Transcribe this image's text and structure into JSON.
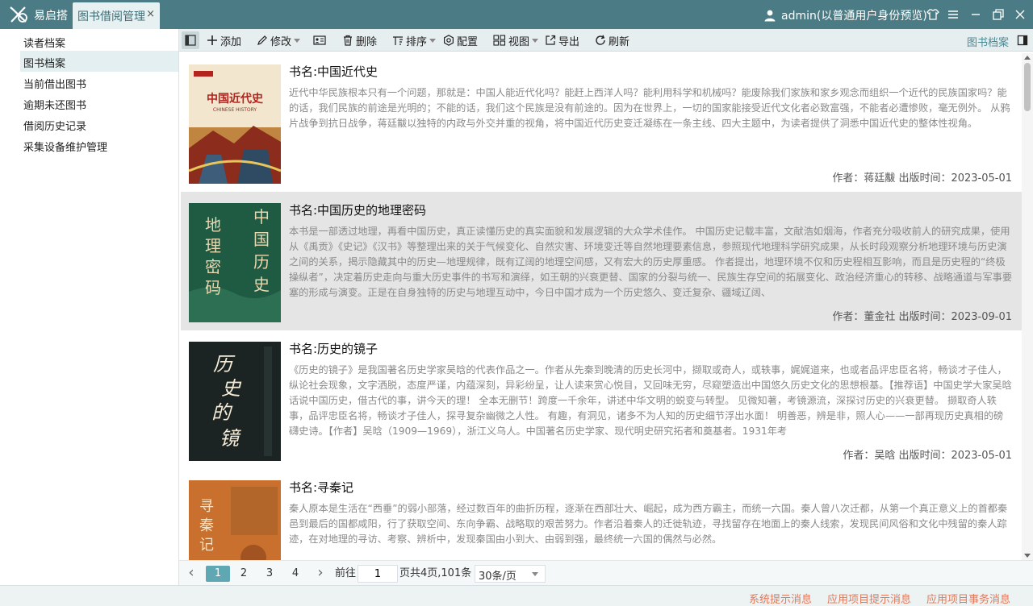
{
  "app": {
    "brand": "易启搭",
    "active_tab": "图书借阅管理",
    "close_glyph": "×",
    "user_label": "admin(以普通用户身份预览)"
  },
  "sidebar": {
    "items": [
      {
        "label": "读者档案"
      },
      {
        "label": "图书档案"
      },
      {
        "label": "当前借出图书"
      },
      {
        "label": "逾期未还图书"
      },
      {
        "label": "借阅历史记录"
      },
      {
        "label": "采集设备维护管理"
      }
    ],
    "active_index": 1
  },
  "toolbar": {
    "add": "添加",
    "edit": "修改",
    "delete": "删除",
    "sort": "排序",
    "config": "配置",
    "view": "视图",
    "export": "导出",
    "refresh": "刷新",
    "right_label": "图书档案"
  },
  "books": [
    {
      "title": "书名:中国近代史",
      "description": "近代中华民族根本只有一个问题，那就是：中国人能近代化吗？能赶上西洋人吗？能利用科学和机械吗？能废除我们家族和家乡观念而组织一个近代的民族国家吗？能的话，我们民族的前途是光明的；不能的话，我们这个民族是没有前途的。因为在世界上，一切的国家能接受近代文化者必致富强，不能者必遭惨败，毫无例外。 从鸦片战争到抗日战争，蒋廷黻以独特的内政与外交并重的视角，将中国近代历史变迁凝练在一条主线、四大主题中，为读者提供了洞悉中国近代史的整体性视角。",
      "meta": "作者：蒋廷黻   出版时间：2023-05-01",
      "cover": {
        "title": "中国近代史",
        "sub": "CHINESE HISTORY",
        "bg": "#f2e6cf",
        "accent": "#b3241e"
      }
    },
    {
      "title": "书名:中国历史的地理密码",
      "description": "本书是一部透过地理，再看中国历史，真正读懂历史的真实面貌和发展逻辑的大众学术佳作。 中国历史记载丰富，文献浩如烟海，作者充分吸收前人的研究成果，使用从《禹贡》《史记》《汉书》等整理出来的关于气候变化、自然灾害、环境变迁等自然地理要素信息，参照现代地理科学研究成果，从长时段观察分析地理环境与历史演之间的关系，揭示隐藏其中的历史—地理规律，既有辽阔的地理空间感，又有宏大的历史厚重感。 作者提出，地理环境不仅和历史程相互影响，而且是历史程的“终极操纵者”，决定着历史走向与重大历史事件的书写和演绎，如王朝的兴衰更替、国家的分裂与统一、民族生存空间的拓展变化、政治经济重心的转移、战略通道与军事要塞的形成与演变。正是在自身独特的历史与地理互动中，今日中国才成为一个历史悠久、变迁复杂、疆域辽阔、",
      "meta": "作者：董金社   出版时间：2023-09-01",
      "cover": {
        "title": "地理密码",
        "sub": "中国历史",
        "bg": "#1f5a43",
        "accent": "#e8d8b0"
      }
    },
    {
      "title": "书名:历史的镜子",
      "description": "《历史的镜子》是我国著名历史学家吴晗的代表作品之一。作者从先秦到晚清的历史长河中，撷取或奇人，或轶事，娓娓道来，也或者品评忠臣名将，畅谈才子佳人，纵论社会现象，文字洒脱，态度严谨，内蕴深刻，异彩纷呈，让人读来赏心悦目，又回味无穷，尽窥塑造出中国悠久历史文化的思想根基。【推荐语】中国史学大家吴晗话说中国历史，借古代的事，讲今天的理！ 全本无删节！跨度一千余年，讲述中华文明的蜕变与转型。 见微知著，考镜源流，深探讨历史的兴衰更替。 撷取奇人轶事，品评忠臣名将，畅谈才子佳人，探寻复杂幽微之人性。 有趣，有洞见，诸多不为人知的历史细节浮出水面！ 明善恶，辨是非，照人心——一部再现历史真相的磅礴史诗。【作者】吴晗（1909—1969），浙江义乌人。中国著名历史学家、现代明史研究拓者和奠基者。1931年考",
      "meta": "作者：吴晗   出版时间：2023-05-01",
      "cover": {
        "title": "历史的镜子",
        "sub": "吴晗",
        "bg": "#1b2422",
        "accent": "#f4ecd8"
      }
    },
    {
      "title": "书名:寻秦记",
      "description": "秦人原本是生活在“西垂”的弱小部落，经过数百年的曲折历程，逐渐在西部壮大、崛起，成为西方霸主，而统一六国。秦人曾八次迁都，从第一个真正意义上的首都秦邑到最后的国都咸阳，行了获取空间、东向争霸、战略取的艰苦努力。作者沿着秦人的迁徙轨迹，寻找留存在地面上的秦人线索，发现民间风俗和文化中残留的秦人踪迹，在对地理的寻访、考察、辨析中，发现秦国由小到大、由弱到强，最终统一六国的偶然与必然。",
      "meta": "",
      "cover": {
        "title": "寻秦记",
        "sub": "",
        "bg": "#c9702e",
        "accent": "#f6e2c2"
      }
    }
  ],
  "hover_index": 1,
  "pagination": {
    "prev_glyph": "‹",
    "next_glyph": "›",
    "pages": [
      "1",
      "2",
      "3",
      "4"
    ],
    "current_page": "1",
    "goto_label": "前往",
    "goto_value": "1",
    "summary": "页共4页,101条",
    "page_size": "30条/页"
  },
  "statusbar": {
    "system_msg": "系统提示消息",
    "app_msg": "应用项目提示消息",
    "task_msg": "应用项目事务消息"
  },
  "colors": {
    "titlebar": "#4b7c85",
    "accent": "#5ea7b3",
    "status_link": "#e0795a"
  }
}
